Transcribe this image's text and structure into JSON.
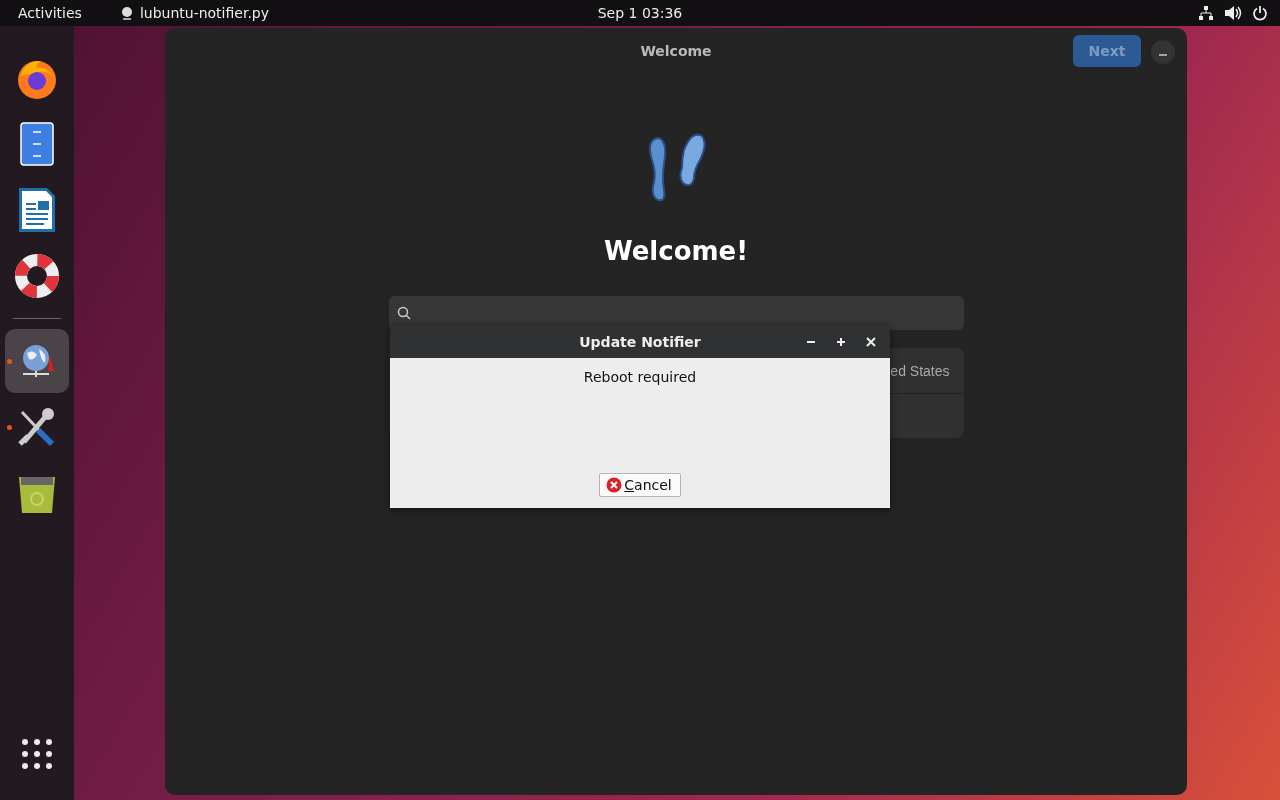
{
  "top_bar": {
    "activities": "Activities",
    "app_name": "lubuntu-notifier.py",
    "clock": "Sep 1  03:36"
  },
  "dock": {
    "items": [
      {
        "kind": "browser",
        "selected": false,
        "running": false
      },
      {
        "kind": "files",
        "selected": false,
        "running": false
      },
      {
        "kind": "writer",
        "selected": false,
        "running": false
      },
      {
        "kind": "help",
        "selected": false,
        "running": false
      },
      {
        "kind": "separator"
      },
      {
        "kind": "network",
        "selected": true,
        "running": true
      },
      {
        "kind": "tools",
        "selected": false,
        "running": true
      },
      {
        "kind": "trash",
        "selected": false,
        "running": false
      },
      {
        "kind": "apps",
        "selected": false,
        "running": false
      }
    ]
  },
  "window": {
    "title": "Welcome",
    "next_button": {
      "label": "Next",
      "disabled": true
    },
    "heading": "Welcome!",
    "list_rows": [
      {
        "text": "ed States"
      },
      {
        "text": ""
      }
    ]
  },
  "dialog": {
    "title": "Update Notifier",
    "message": "Reboot required",
    "button": {
      "label": "Cancel",
      "mnemonic_underlined": true
    }
  }
}
